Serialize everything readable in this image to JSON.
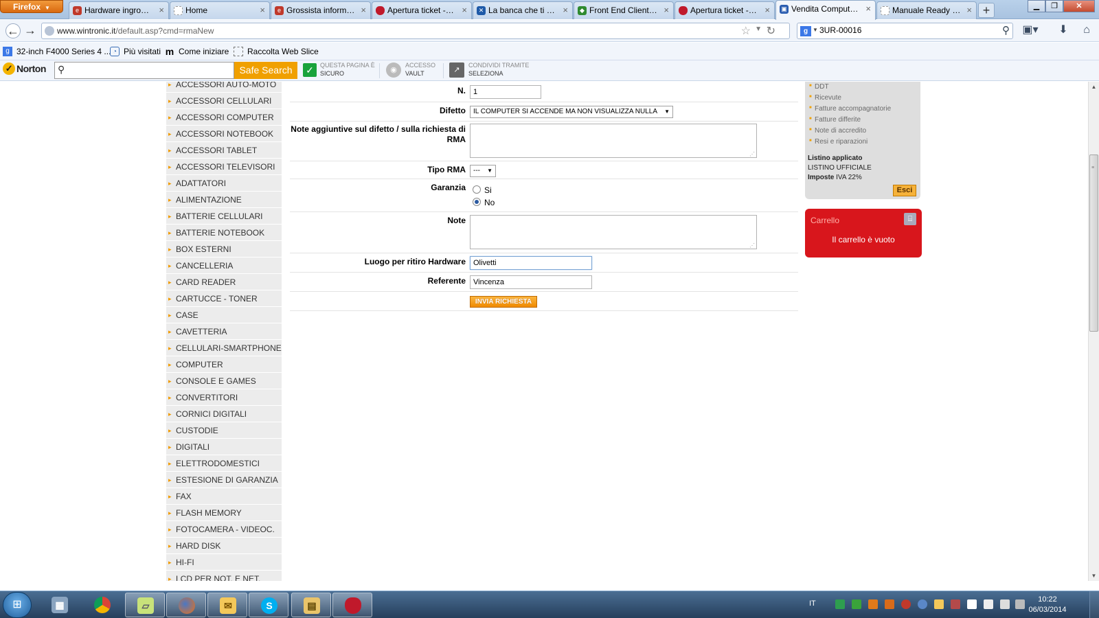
{
  "browser": {
    "menu_label": "Firefox",
    "tabs": [
      {
        "label": "Hardware ingrosso...",
        "icon": "ie-icon",
        "color": "#c0392b"
      },
      {
        "label": "Home",
        "icon": "page-icon",
        "color": "#ffffff"
      },
      {
        "label": "Grossista informat...",
        "icon": "ie-icon",
        "color": "#c0392b"
      },
      {
        "label": "Apertura ticket - R...",
        "icon": "strawberry-icon",
        "color": "#c0192b"
      },
      {
        "label": "La banca che ti è ...",
        "icon": "bank-icon",
        "color": "#1e5aa8"
      },
      {
        "label": "Front End Clienti -...",
        "icon": "leaf-icon",
        "color": "#2f8a2f"
      },
      {
        "label": "Apertura ticket - R...",
        "icon": "strawberry-icon",
        "color": "#c0192b"
      },
      {
        "label": "Vendita Computer...",
        "icon": "shop-icon",
        "color": "#2a5db0"
      },
      {
        "label": "Manuale Ready Pro",
        "icon": "page-icon",
        "color": "#ffffff"
      }
    ],
    "active_tab": 7,
    "new_tab_label": "+",
    "url_domain": "www.wintronic.it",
    "url_path": "/default.asp?cmd=rmaNew",
    "search_value": "3UR-00016",
    "bookmarks": [
      {
        "label": "32-inch F4000 Series 4 ...",
        "icon": "google-icon"
      },
      {
        "label": "Più visitati",
        "icon": "bookmark-icon"
      },
      {
        "label": "Come iniziare",
        "icon": "m-icon"
      },
      {
        "label": "Raccolta Web Slice",
        "icon": "webslice-icon"
      }
    ]
  },
  "norton": {
    "logo": "Norton",
    "search_placeholder": "",
    "search_button": "Safe Search",
    "item1_top": "QUESTA PAGINA È",
    "item1_bottom": "SICURO",
    "item2_top": "ACCESSO",
    "item2_bottom": "VAULT",
    "item3_top": "CONDIVIDI TRAMITE",
    "item3_bottom": "SELEZIONA"
  },
  "categories": [
    "ACCESSORI AUTO-MOTO",
    "ACCESSORI CELLULARI",
    "ACCESSORI COMPUTER",
    "ACCESSORI NOTEBOOK",
    "ACCESSORI TABLET",
    "ACCESSORI TELEVISORI",
    "ADATTATORI",
    "ALIMENTAZIONE",
    "BATTERIE CELLULARI",
    "BATTERIE NOTEBOOK",
    "BOX ESTERNI",
    "CANCELLERIA",
    "CARD READER",
    "CARTUCCE - TONER",
    "CASE",
    "CAVETTERIA",
    "CELLULARI-SMARTPHONE",
    "COMPUTER",
    "CONSOLE E GAMES",
    "CONVERTITORI",
    "CORNICI DIGITALI",
    "CUSTODIE",
    "DIGITALI",
    "ELETTRODOMESTICI",
    "ESTESIONE DI GARANZIA",
    "FAX",
    "FLASH MEMORY",
    "FOTOCAMERA - VIDEOC.",
    "HARD DISK",
    "HI-FI",
    "LCD PER NOT. E NET."
  ],
  "form": {
    "n_label": "N.",
    "n_value": "1",
    "difetto_label": "Difetto",
    "difetto_value": "IL COMPUTER SI ACCENDE MA NON VISUALIZZA NULLA",
    "note_agg_label": "Note aggiuntive sul difetto / sulla richiesta di RMA",
    "tipo_label": "Tipo RMA",
    "tipo_value": "---",
    "garanzia_label": "Garanzia",
    "garanzia_si": "Si",
    "garanzia_no": "No",
    "garanzia_selected": "No",
    "note_label": "Note",
    "luogo_label": "Luogo per ritiro Hardware",
    "luogo_value": "Olivetti",
    "referente_label": "Referente",
    "referente_value": "Vincenza",
    "submit_label": "INVIA RICHIESTA"
  },
  "account_panel": {
    "links": [
      "DDT",
      "Ricevute",
      "Fatture accompagnatorie",
      "Fatture differite",
      "Note di accredito",
      "Resi e riparazioni"
    ],
    "listino_label": "Listino applicato",
    "listino_value": "LISTINO UFFICIALE",
    "imposte_label": "Imposte",
    "imposte_value": "IVA 22%",
    "logout_label": "Esci"
  },
  "cart": {
    "title": "Carrello",
    "empty_message": "Il carrello è vuoto"
  },
  "taskbar": {
    "language": "IT",
    "time": "10:22",
    "date": "06/03/2014"
  }
}
